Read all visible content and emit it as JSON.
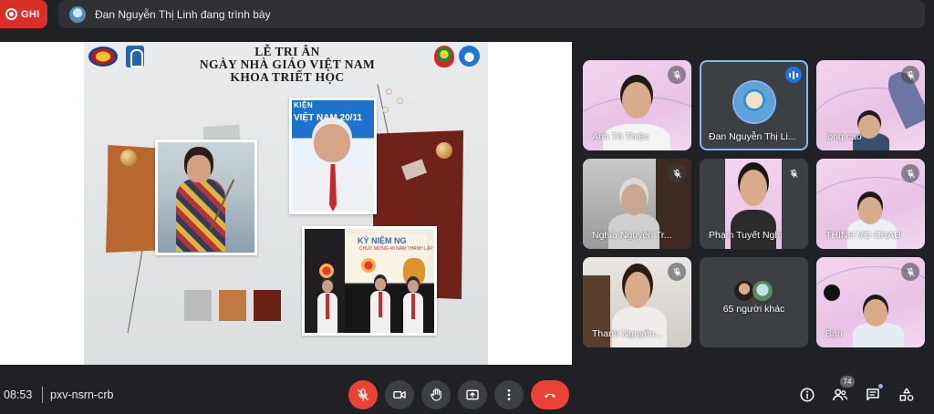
{
  "recording": {
    "label": "GHI"
  },
  "presenting_bar": {
    "text": "Đan Nguyễn Thị Linh đang trình bày"
  },
  "slide": {
    "title_line1": "LỄ TRI ÂN",
    "title_line2": "NGÀY NHÀ GIÁO VIỆT NAM",
    "title_line3": "KHOA TRIẾT HỌC",
    "photo2_banner_top": "KIỆN",
    "photo2_banner": "VIỆT NAM 20/11",
    "photo3_banner": "KỶ NIỆM NG",
    "photo3_sub": "CHÚC MỪNG 40 NĂM THÀNH LẬP",
    "palette": [
      "#b9bbbc",
      "#c07a3f",
      "#6c2117"
    ]
  },
  "participants": [
    {
      "name": "Anh Tô Thiên",
      "muted": true,
      "speaking": false
    },
    {
      "name": "Đan Nguyễn Thị Li...",
      "muted": false,
      "speaking": true
    },
    {
      "name": "long cao",
      "muted": true,
      "speaking": false
    },
    {
      "name": "Nghĩa Nguyễn Tr...",
      "muted": true,
      "speaking": false
    },
    {
      "name": "Phạm Tuyết Nghi",
      "muted": true,
      "speaking": false
    },
    {
      "name": "THINH VO CHAU",
      "muted": true,
      "speaking": false
    },
    {
      "name": "Thanh Nguyễn...",
      "muted": true,
      "speaking": false
    },
    {
      "name": "65 người khác",
      "muted": false,
      "speaking": false
    },
    {
      "name": "Bạn",
      "muted": true,
      "speaking": false
    }
  ],
  "bottom_bar": {
    "time": "08:53",
    "meeting_code": "pxv-nsrn-crb",
    "people_count": "74"
  },
  "colors": {
    "background": "#202124",
    "end_call": "#ea4335",
    "record": "#d93025",
    "active_speaker": "#1a73e8"
  },
  "icons": {
    "controls": [
      "mic-off-icon",
      "camera-icon",
      "raise-hand-icon",
      "present-screen-icon",
      "more-options-icon",
      "end-call-icon"
    ],
    "right": [
      "info-icon",
      "people-icon",
      "chat-icon",
      "activities-icon"
    ]
  }
}
